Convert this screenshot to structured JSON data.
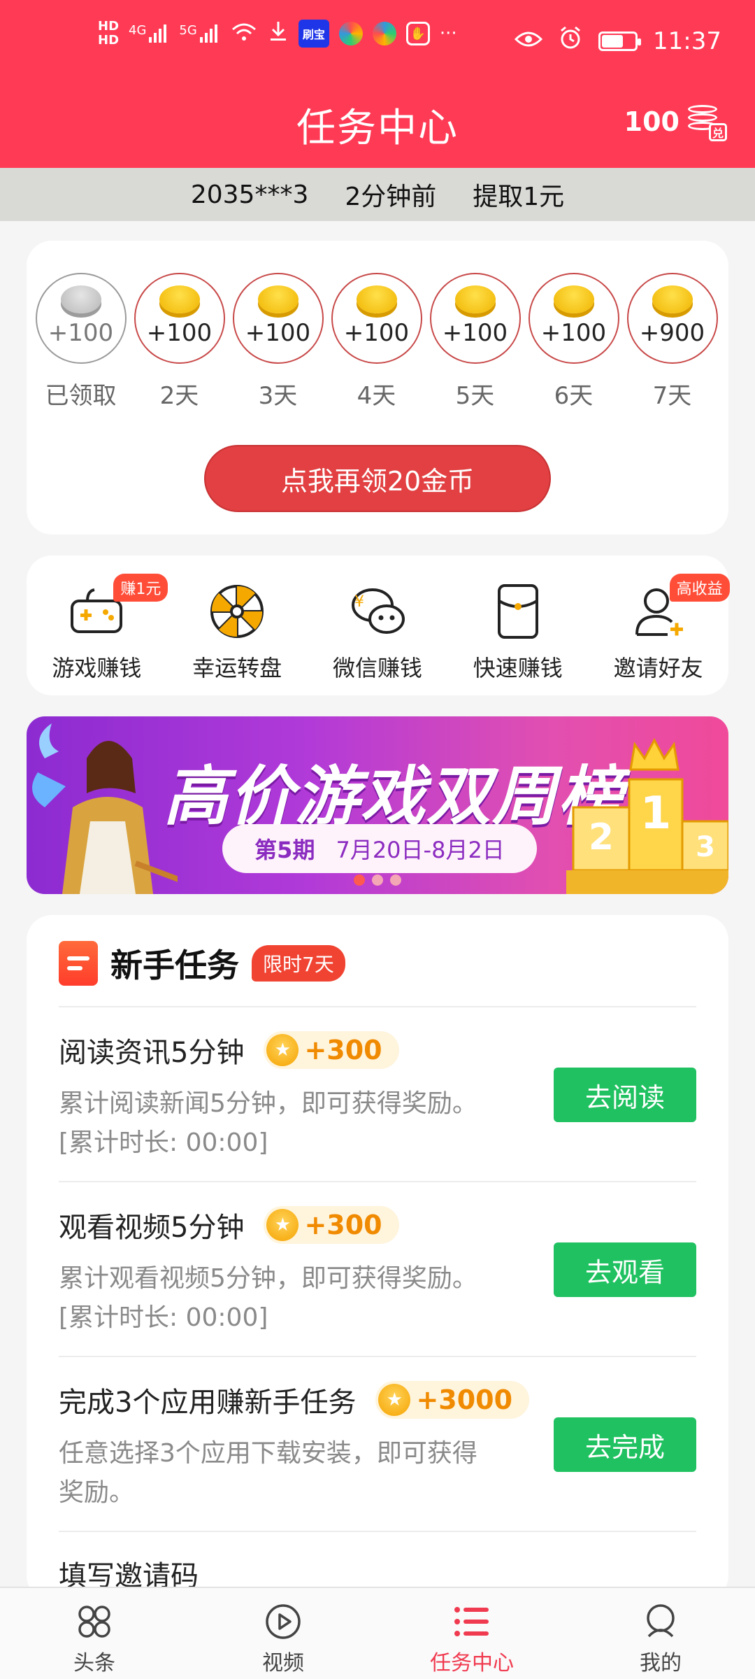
{
  "status_bar": {
    "time": "11:37",
    "net1": "4G",
    "net2": "5G",
    "hd1": "HD",
    "hd2": "HD",
    "app_chip": "刷宝",
    "more": "···"
  },
  "header": {
    "title": "任务中心",
    "coins": "100",
    "coin_tag": "兑"
  },
  "ticker": {
    "user": "2035***3",
    "time_ago": "2分钟前",
    "action": "提取1元"
  },
  "checkin": {
    "days": [
      {
        "amount": "+100",
        "label": "已领取",
        "claimed": true
      },
      {
        "amount": "+100",
        "label": "2天",
        "claimed": false
      },
      {
        "amount": "+100",
        "label": "3天",
        "claimed": false
      },
      {
        "amount": "+100",
        "label": "4天",
        "claimed": false
      },
      {
        "amount": "+100",
        "label": "5天",
        "claimed": false
      },
      {
        "amount": "+100",
        "label": "6天",
        "claimed": false
      },
      {
        "amount": "+900",
        "label": "7天",
        "claimed": false
      }
    ],
    "button": "点我再领20金币"
  },
  "shortcuts": [
    {
      "label": "游戏赚钱",
      "badge": "赚1元",
      "icon": "gamepad-icon"
    },
    {
      "label": "幸运转盘",
      "badge": "",
      "icon": "wheel-icon"
    },
    {
      "label": "微信赚钱",
      "badge": "",
      "icon": "wechat-icon"
    },
    {
      "label": "快速赚钱",
      "badge": "",
      "icon": "envelope-icon"
    },
    {
      "label": "邀请好友",
      "badge": "高收益",
      "icon": "invite-user-icon"
    }
  ],
  "banner": {
    "title": "高价游戏双周榜",
    "issue": "第5期",
    "date_range": "7月20日-8月2日",
    "podium": [
      "2",
      "1",
      "3"
    ],
    "active_dot": 0,
    "dot_count": 3
  },
  "newbie_tasks": {
    "title": "新手任务",
    "limit_badge": "限时7天",
    "items": [
      {
        "name": "阅读资讯5分钟",
        "reward": "+300",
        "desc": "累计阅读新闻5分钟，即可获得奖励。[累计时长: 00:00]",
        "button": "去阅读"
      },
      {
        "name": "观看视频5分钟",
        "reward": "+300",
        "desc": "累计观看视频5分钟，即可获得奖励。[累计时长: 00:00]",
        "button": "去观看"
      },
      {
        "name": "完成3个应用赚新手任务",
        "reward": "+3000",
        "desc": "任意选择3个应用下载安装，即可获得奖励。",
        "button": "去完成"
      },
      {
        "name": "填写邀请码",
        "reward": "",
        "desc": "",
        "button": ""
      }
    ]
  },
  "bottom_nav": [
    {
      "label": "头条",
      "icon": "headlines-icon",
      "active": false
    },
    {
      "label": "视频",
      "icon": "video-play-icon",
      "active": false
    },
    {
      "label": "任务中心",
      "icon": "task-list-icon",
      "active": true
    },
    {
      "label": "我的",
      "icon": "profile-icon",
      "active": false
    }
  ],
  "colors": {
    "brand_red": "#ff3a55",
    "claim_button": "#e24042",
    "go_button": "#20c161",
    "reward_text": "#f08a00",
    "nav_active": "#f03a4f"
  }
}
